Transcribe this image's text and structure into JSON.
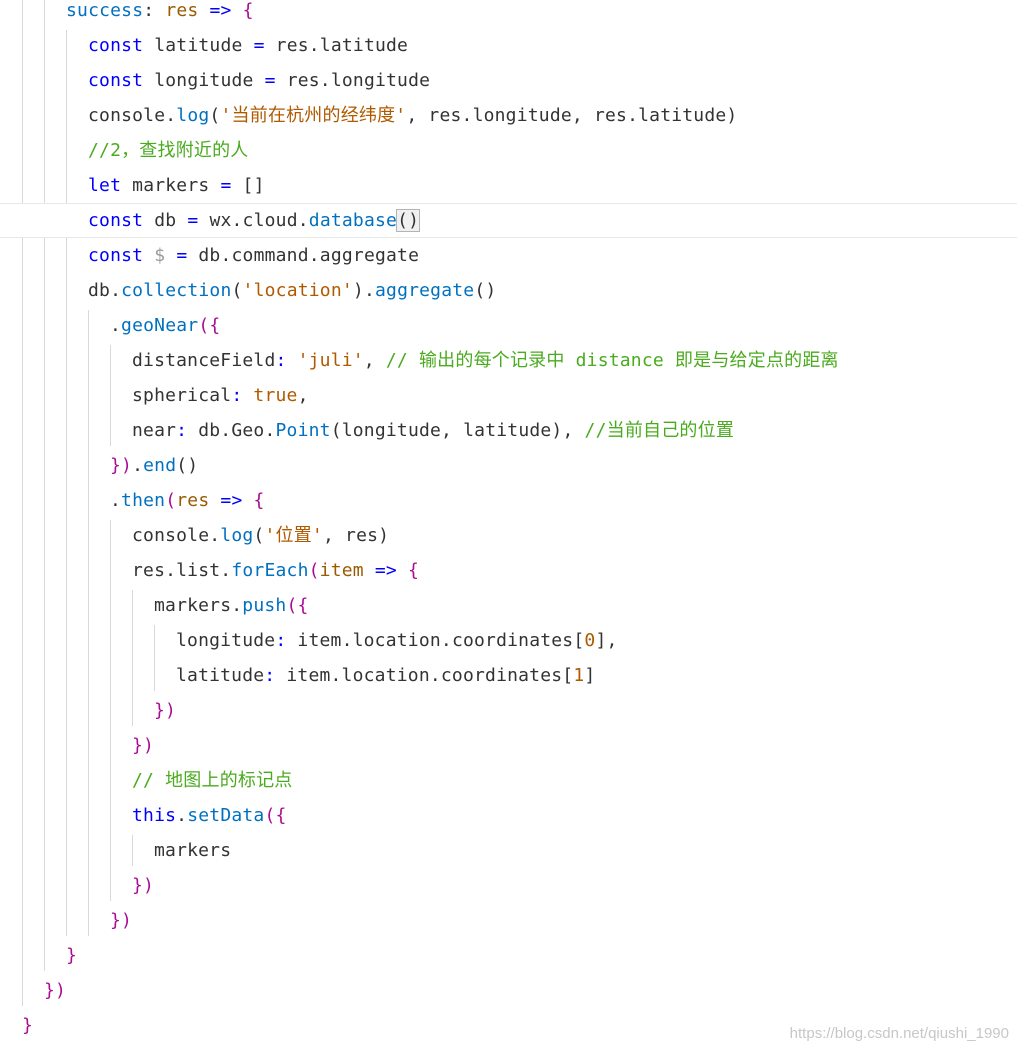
{
  "colors": {
    "keyword": "#0000ff",
    "function": "#0070c1",
    "string": "#b05a00",
    "comment": "#4aab1e",
    "param": "#9b5a00",
    "bracket": "#a90d91",
    "number": "#b05a00",
    "plain": "#333333"
  },
  "watermark": "https://blog.csdn.net/qiushi_1990",
  "lines": [
    {
      "indent": 66,
      "tokens": [
        [
          "success",
          "fn"
        ],
        [
          ": ",
          "p"
        ],
        [
          "res",
          "param"
        ],
        [
          " => ",
          "kw"
        ],
        [
          "{",
          "br"
        ]
      ]
    },
    {
      "indent": 88,
      "tokens": [
        [
          "const ",
          "kw"
        ],
        [
          "latitude ",
          "p"
        ],
        [
          "= ",
          "kw"
        ],
        [
          "res.latitude",
          "p"
        ]
      ]
    },
    {
      "indent": 88,
      "tokens": [
        [
          "const ",
          "kw"
        ],
        [
          "longitude ",
          "p"
        ],
        [
          "= ",
          "kw"
        ],
        [
          "res.longitude",
          "p"
        ]
      ]
    },
    {
      "indent": 88,
      "tokens": [
        [
          "console.",
          "p"
        ],
        [
          "log",
          "fn"
        ],
        [
          "(",
          "p"
        ],
        [
          "'当前在杭州的经纬度'",
          "str"
        ],
        [
          ", res.longitude, res.latitude)",
          "p"
        ]
      ]
    },
    {
      "indent": 88,
      "tokens": [
        [
          "//2，查找附近的人",
          "cm"
        ]
      ]
    },
    {
      "indent": 88,
      "tokens": [
        [
          "let ",
          "kw"
        ],
        [
          "markers ",
          "p"
        ],
        [
          "= ",
          "kw"
        ],
        [
          "[]",
          "p"
        ]
      ]
    },
    {
      "indent": 88,
      "current": true,
      "tokens": [
        [
          "const ",
          "kw"
        ],
        [
          "db ",
          "p"
        ],
        [
          "= ",
          "kw"
        ],
        [
          "wx.cloud.",
          "p"
        ],
        [
          "database",
          "fn"
        ],
        [
          "()",
          "hl"
        ]
      ]
    },
    {
      "indent": 88,
      "tokens": [
        [
          "const ",
          "kw"
        ],
        [
          "$ ",
          "dim"
        ],
        [
          "= ",
          "kw"
        ],
        [
          "db.command.aggregate",
          "p"
        ]
      ]
    },
    {
      "indent": 88,
      "tokens": [
        [
          "db.",
          "p"
        ],
        [
          "collection",
          "fn"
        ],
        [
          "(",
          "p"
        ],
        [
          "'location'",
          "str"
        ],
        [
          ").",
          "p"
        ],
        [
          "aggregate",
          "fn"
        ],
        [
          "()",
          "p"
        ]
      ]
    },
    {
      "indent": 110,
      "tokens": [
        [
          ".",
          "p"
        ],
        [
          "geoNear",
          "fn"
        ],
        [
          "({",
          "br"
        ]
      ]
    },
    {
      "indent": 132,
      "tokens": [
        [
          "distanceField",
          "p"
        ],
        [
          ": ",
          "kw"
        ],
        [
          "'juli'",
          "str"
        ],
        [
          ", ",
          "p"
        ],
        [
          "// 输出的每个记录中 distance 即是与给定点的距离",
          "cm"
        ]
      ]
    },
    {
      "indent": 132,
      "tokens": [
        [
          "spherical",
          "p"
        ],
        [
          ": ",
          "kw"
        ],
        [
          "true",
          "num"
        ],
        [
          ",",
          "p"
        ]
      ]
    },
    {
      "indent": 132,
      "tokens": [
        [
          "near",
          "p"
        ],
        [
          ": ",
          "kw"
        ],
        [
          "db.Geo.",
          "p"
        ],
        [
          "Point",
          "fn"
        ],
        [
          "(longitude, latitude), ",
          "p"
        ],
        [
          "//当前自己的位置",
          "cm"
        ]
      ]
    },
    {
      "indent": 110,
      "tokens": [
        [
          "})",
          "br"
        ],
        [
          ".",
          "p"
        ],
        [
          "end",
          "fn"
        ],
        [
          "()",
          "p"
        ]
      ]
    },
    {
      "indent": 110,
      "tokens": [
        [
          ".",
          "p"
        ],
        [
          "then",
          "fn"
        ],
        [
          "(",
          "br"
        ],
        [
          "res",
          "param"
        ],
        [
          " => ",
          "kw"
        ],
        [
          "{",
          "br"
        ]
      ]
    },
    {
      "indent": 132,
      "tokens": [
        [
          "console.",
          "p"
        ],
        [
          "log",
          "fn"
        ],
        [
          "(",
          "p"
        ],
        [
          "'位置'",
          "str"
        ],
        [
          ", res)",
          "p"
        ]
      ]
    },
    {
      "indent": 132,
      "tokens": [
        [
          "res.list.",
          "p"
        ],
        [
          "forEach",
          "fn"
        ],
        [
          "(",
          "br"
        ],
        [
          "item",
          "param"
        ],
        [
          " => ",
          "kw"
        ],
        [
          "{",
          "br"
        ]
      ]
    },
    {
      "indent": 154,
      "tokens": [
        [
          "markers.",
          "p"
        ],
        [
          "push",
          "fn"
        ],
        [
          "({",
          "br"
        ]
      ]
    },
    {
      "indent": 176,
      "tokens": [
        [
          "longitude",
          "p"
        ],
        [
          ": ",
          "kw"
        ],
        [
          "item.location.coordinates[",
          "p"
        ],
        [
          "0",
          "num"
        ],
        [
          "],",
          "p"
        ]
      ]
    },
    {
      "indent": 176,
      "tokens": [
        [
          "latitude",
          "p"
        ],
        [
          ": ",
          "kw"
        ],
        [
          "item.location.coordinates[",
          "p"
        ],
        [
          "1",
          "num"
        ],
        [
          "]",
          "p"
        ]
      ]
    },
    {
      "indent": 154,
      "tokens": [
        [
          "})",
          "br"
        ]
      ]
    },
    {
      "indent": 132,
      "tokens": [
        [
          "})",
          "br"
        ]
      ]
    },
    {
      "indent": 132,
      "tokens": [
        [
          "// 地图上的标记点",
          "cm"
        ]
      ]
    },
    {
      "indent": 132,
      "tokens": [
        [
          "this",
          "kw"
        ],
        [
          ".",
          "p"
        ],
        [
          "setData",
          "fn"
        ],
        [
          "({",
          "br"
        ]
      ]
    },
    {
      "indent": 154,
      "tokens": [
        [
          "markers",
          "p"
        ]
      ]
    },
    {
      "indent": 132,
      "tokens": [
        [
          "})",
          "br"
        ]
      ]
    },
    {
      "indent": 110,
      "tokens": [
        [
          "})",
          "br"
        ]
      ]
    },
    {
      "indent": 66,
      "tokens": [
        [
          "}",
          "br"
        ]
      ]
    },
    {
      "indent": 44,
      "tokens": [
        [
          "})",
          "br"
        ]
      ]
    },
    {
      "indent": 22,
      "tokens": [
        [
          "}",
          "br"
        ]
      ]
    }
  ]
}
